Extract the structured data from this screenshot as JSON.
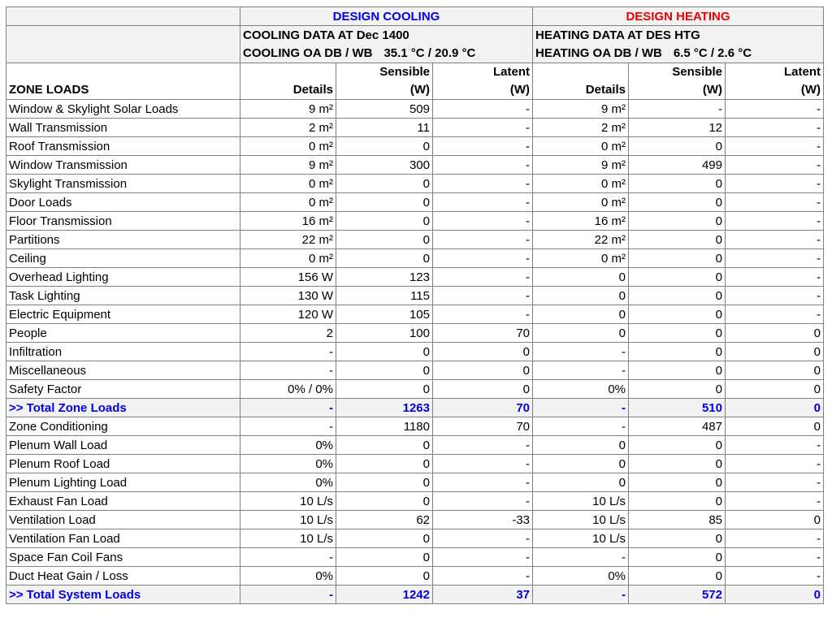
{
  "header": {
    "cooling_title": "DESIGN COOLING",
    "heating_title": "DESIGN HEATING",
    "cooling_data_at": "COOLING DATA AT Dec 1400",
    "cooling_oa_label": "COOLING OA DB / WB",
    "cooling_oa_value": "35.1 °C / 20.9 °C",
    "heating_data_at": "HEATING DATA AT DES HTG",
    "heating_oa_label": "HEATING OA DB / WB",
    "heating_oa_value": "6.5 °C / 2.6 °C",
    "zone_loads": "ZONE LOADS",
    "columns": {
      "cool_details": "Details",
      "cool_sensible_1": "Sensible",
      "cool_sensible_2": "(W)",
      "cool_latent_1": "Latent",
      "cool_latent_2": "(W)",
      "heat_details": "Details",
      "heat_sensible_1": "Sensible",
      "heat_sensible_2": "(W)",
      "heat_latent_1": "Latent",
      "heat_latent_2": "(W)"
    }
  },
  "colors": {
    "cooling_title": "#0000ee",
    "heating_title": "#ee0000",
    "total_text": "#0000ee",
    "header_bg": "#f2f2f2"
  },
  "rows": [
    {
      "label": "Window & Skylight Solar Loads",
      "c_details": "9 m²",
      "c_sensible": "509",
      "c_latent": "-",
      "h_details": "9 m²",
      "h_sensible": "-",
      "h_latent": "-",
      "total": false
    },
    {
      "label": "Wall Transmission",
      "c_details": "2 m²",
      "c_sensible": "11",
      "c_latent": "-",
      "h_details": "2 m²",
      "h_sensible": "12",
      "h_latent": "-",
      "total": false
    },
    {
      "label": "Roof Transmission",
      "c_details": "0 m²",
      "c_sensible": "0",
      "c_latent": "-",
      "h_details": "0 m²",
      "h_sensible": "0",
      "h_latent": "-",
      "total": false
    },
    {
      "label": "Window Transmission",
      "c_details": "9 m²",
      "c_sensible": "300",
      "c_latent": "-",
      "h_details": "9 m²",
      "h_sensible": "499",
      "h_latent": "-",
      "total": false
    },
    {
      "label": "Skylight Transmission",
      "c_details": "0 m²",
      "c_sensible": "0",
      "c_latent": "-",
      "h_details": "0 m²",
      "h_sensible": "0",
      "h_latent": "-",
      "total": false
    },
    {
      "label": "Door Loads",
      "c_details": "0 m²",
      "c_sensible": "0",
      "c_latent": "-",
      "h_details": "0 m²",
      "h_sensible": "0",
      "h_latent": "-",
      "total": false
    },
    {
      "label": "Floor Transmission",
      "c_details": "16 m²",
      "c_sensible": "0",
      "c_latent": "-",
      "h_details": "16 m²",
      "h_sensible": "0",
      "h_latent": "-",
      "total": false
    },
    {
      "label": "Partitions",
      "c_details": "22 m²",
      "c_sensible": "0",
      "c_latent": "-",
      "h_details": "22 m²",
      "h_sensible": "0",
      "h_latent": "-",
      "total": false
    },
    {
      "label": "Ceiling",
      "c_details": "0 m²",
      "c_sensible": "0",
      "c_latent": "-",
      "h_details": "0 m²",
      "h_sensible": "0",
      "h_latent": "-",
      "total": false
    },
    {
      "label": "Overhead Lighting",
      "c_details": "156 W",
      "c_sensible": "123",
      "c_latent": "-",
      "h_details": "0",
      "h_sensible": "0",
      "h_latent": "-",
      "total": false
    },
    {
      "label": "Task Lighting",
      "c_details": "130 W",
      "c_sensible": "115",
      "c_latent": "-",
      "h_details": "0",
      "h_sensible": "0",
      "h_latent": "-",
      "total": false
    },
    {
      "label": "Electric Equipment",
      "c_details": "120 W",
      "c_sensible": "105",
      "c_latent": "-",
      "h_details": "0",
      "h_sensible": "0",
      "h_latent": "-",
      "total": false
    },
    {
      "label": "People",
      "c_details": "2",
      "c_sensible": "100",
      "c_latent": "70",
      "h_details": "0",
      "h_sensible": "0",
      "h_latent": "0",
      "total": false
    },
    {
      "label": "Infiltration",
      "c_details": "-",
      "c_sensible": "0",
      "c_latent": "0",
      "h_details": "-",
      "h_sensible": "0",
      "h_latent": "0",
      "total": false
    },
    {
      "label": "Miscellaneous",
      "c_details": "-",
      "c_sensible": "0",
      "c_latent": "0",
      "h_details": "-",
      "h_sensible": "0",
      "h_latent": "0",
      "total": false
    },
    {
      "label": "Safety Factor",
      "c_details": "0% / 0%",
      "c_sensible": "0",
      "c_latent": "0",
      "h_details": "0%",
      "h_sensible": "0",
      "h_latent": "0",
      "total": false
    },
    {
      "label": ">> Total Zone Loads",
      "c_details": "-",
      "c_sensible": "1263",
      "c_latent": "70",
      "h_details": "-",
      "h_sensible": "510",
      "h_latent": "0",
      "total": true
    },
    {
      "label": "Zone Conditioning",
      "c_details": "-",
      "c_sensible": "1180",
      "c_latent": "70",
      "h_details": "-",
      "h_sensible": "487",
      "h_latent": "0",
      "total": false
    },
    {
      "label": "Plenum Wall Load",
      "c_details": "0%",
      "c_sensible": "0",
      "c_latent": "-",
      "h_details": "0",
      "h_sensible": "0",
      "h_latent": "-",
      "total": false
    },
    {
      "label": "Plenum Roof Load",
      "c_details": "0%",
      "c_sensible": "0",
      "c_latent": "-",
      "h_details": "0",
      "h_sensible": "0",
      "h_latent": "-",
      "total": false
    },
    {
      "label": "Plenum Lighting Load",
      "c_details": "0%",
      "c_sensible": "0",
      "c_latent": "-",
      "h_details": "0",
      "h_sensible": "0",
      "h_latent": "-",
      "total": false
    },
    {
      "label": "Exhaust Fan Load",
      "c_details": "10 L/s",
      "c_sensible": "0",
      "c_latent": "-",
      "h_details": "10 L/s",
      "h_sensible": "0",
      "h_latent": "-",
      "total": false
    },
    {
      "label": "Ventilation Load",
      "c_details": "10 L/s",
      "c_sensible": "62",
      "c_latent": "-33",
      "h_details": "10 L/s",
      "h_sensible": "85",
      "h_latent": "0",
      "total": false
    },
    {
      "label": "Ventilation Fan Load",
      "c_details": "10 L/s",
      "c_sensible": "0",
      "c_latent": "-",
      "h_details": "10 L/s",
      "h_sensible": "0",
      "h_latent": "-",
      "total": false
    },
    {
      "label": "Space Fan Coil Fans",
      "c_details": "-",
      "c_sensible": "0",
      "c_latent": "-",
      "h_details": "-",
      "h_sensible": "0",
      "h_latent": "-",
      "total": false
    },
    {
      "label": "Duct Heat Gain / Loss",
      "c_details": "0%",
      "c_sensible": "0",
      "c_latent": "-",
      "h_details": "0%",
      "h_sensible": "0",
      "h_latent": "-",
      "total": false
    },
    {
      "label": ">> Total System Loads",
      "c_details": "-",
      "c_sensible": "1242",
      "c_latent": "37",
      "h_details": "-",
      "h_sensible": "572",
      "h_latent": "0",
      "total": true
    }
  ]
}
